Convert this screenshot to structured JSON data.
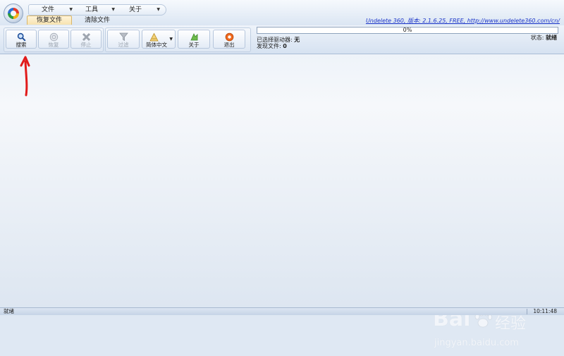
{
  "menu": {
    "items": [
      {
        "label": "文件"
      },
      {
        "label": "工具"
      },
      {
        "label": "关于"
      }
    ]
  },
  "tabs": [
    {
      "label": "恢复文件",
      "active": true
    },
    {
      "label": "清除文件",
      "active": false
    }
  ],
  "version_link": "Undelete 360, 版本: 2.1.6.25, FREE, http://www.undelete360.com/cn/",
  "ribbon": {
    "search": "搜索",
    "recover": "恢复",
    "stop": "停止",
    "filter": "过滤",
    "language": "简体中文",
    "about": "关于",
    "exit": "退出"
  },
  "progress": {
    "text": "0%",
    "fraction": 0.0
  },
  "info": {
    "drive_label": "已选择驱动器:",
    "drive_value": "无",
    "found_label": "发现文件:",
    "found_value": "0",
    "state_label": "状态:",
    "state_value": "就绪"
  },
  "watermark": {
    "brand": "Bai",
    "brand_suffix": "经验",
    "url": "jingyan.baidu.com"
  },
  "statusbar": {
    "left": "就绪",
    "time": "10:11:48"
  },
  "colors": {
    "annotation_arrow": "#e11b1b",
    "link": "#1a33c8",
    "progress_fill": "#5fb85a"
  }
}
